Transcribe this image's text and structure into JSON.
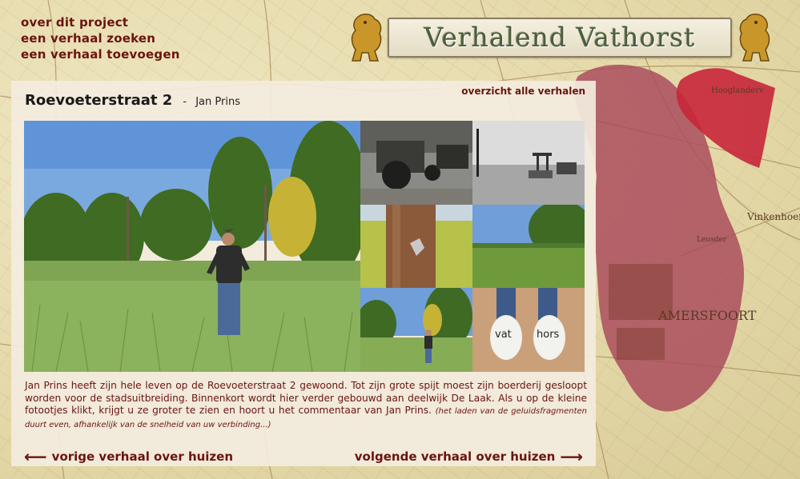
{
  "nav": {
    "items": [
      {
        "label": "over dit project"
      },
      {
        "label": "een verhaal zoeken"
      },
      {
        "label": "een verhaal toevoegen"
      }
    ]
  },
  "banner": {
    "title": "Verhalend Vathorst",
    "lion_icon": "heraldic-lion-icon"
  },
  "map": {
    "region_color": "#a8485a",
    "highlight_color": "#c8263a",
    "labels": [
      "AMERSFOORT",
      "Vinkenhoef",
      "Hooglanderv",
      "Leusder"
    ]
  },
  "story": {
    "title": "Roevoeterstraat 2",
    "separator": "-",
    "author": "Jan Prins",
    "overview_link": "overzicht alle verhalen",
    "description": "Jan Prins heeft zijn hele leven op de Roevoeterstraat 2 gewoond. Tot zijn grote spijt moest zijn boerderij gesloopt worden voor de stadsuitbreiding. Binnenkort wordt hier verder gebouwd aan deelwijk De Laak. Als u op de kleine fotootjes klikt, krijgt u ze groter te zien en hoort u het commentaar van Jan Prins.",
    "note": "(het laden van de geluidsfragmenten duurt even, afhankelijk van de snelheid van uw verbinding...)",
    "clog_text_left": "vat",
    "clog_text_right": "hors"
  },
  "pager": {
    "prev_label": "vorige verhaal over huizen",
    "next_label": "volgende verhaal over huizen",
    "prev_arrow": "⟵",
    "next_arrow": "⟶"
  },
  "colors": {
    "link": "#6a1410",
    "panel": "#f3ecde",
    "banner_text": "#4e5d3a"
  }
}
